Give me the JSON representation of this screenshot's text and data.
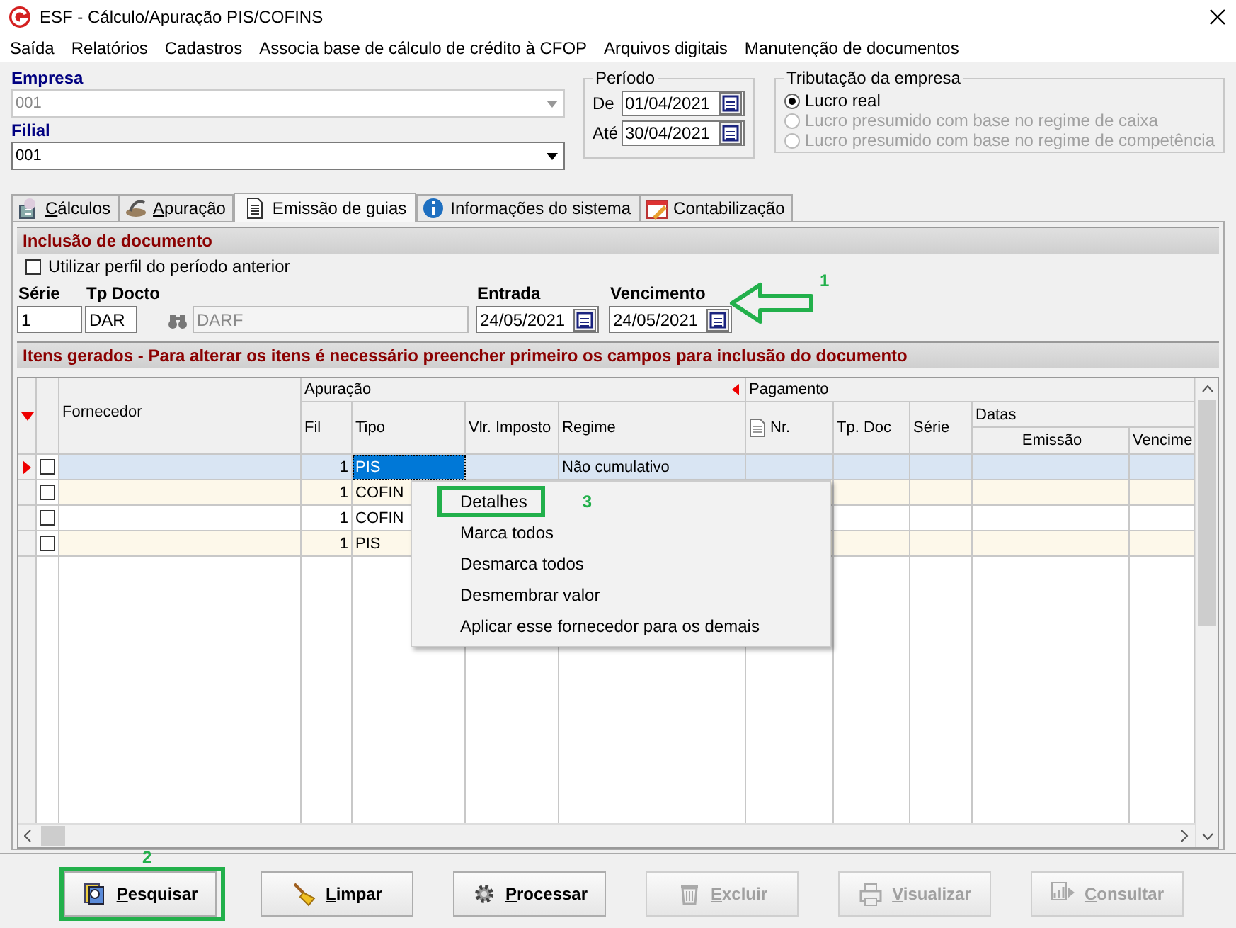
{
  "window": {
    "title": "ESF - Cálculo/Apuração PIS/COFINS"
  },
  "menu": [
    "Saída",
    "Relatórios",
    "Cadastros",
    "Associa base de cálculo de crédito à CFOP",
    "Arquivos digitais",
    "Manutenção de documentos"
  ],
  "empresa": {
    "label": "Empresa",
    "value": "001",
    "disabled": true
  },
  "filial": {
    "label": "Filial",
    "value": "001",
    "disabled": false
  },
  "periodo": {
    "title": "Período",
    "from_label": "De",
    "from": "01/04/2021",
    "to_label": "Até",
    "to": "30/04/2021"
  },
  "tributacao": {
    "title": "Tributação da empresa",
    "options": [
      {
        "label": "Lucro real",
        "selected": true,
        "disabled": false
      },
      {
        "label": "Lucro presumido com base no regime de caixa",
        "selected": false,
        "disabled": true
      },
      {
        "label": "Lucro presumido com base no regime de competência",
        "selected": false,
        "disabled": true
      }
    ]
  },
  "tabs": [
    {
      "label": "Cálculos",
      "selected": false
    },
    {
      "label": "Apuração",
      "selected": false
    },
    {
      "label": "Emissão de guias",
      "selected": true
    },
    {
      "label": "Informações do sistema",
      "selected": false
    },
    {
      "label": "Contabilização",
      "selected": false
    }
  ],
  "inclusao": {
    "title": "Inclusão de documento",
    "use_previous": {
      "label": "Utilizar perfil do período anterior",
      "checked": false
    },
    "serie": {
      "label": "Série",
      "value": "1"
    },
    "tp_docto": {
      "label": "Tp Docto",
      "value": "DAR",
      "description": "DARF"
    },
    "entrada": {
      "label": "Entrada",
      "value": "24/05/2021"
    },
    "vencimento": {
      "label": "Vencimento",
      "value": "24/05/2021"
    },
    "annotation": "1"
  },
  "itens": {
    "title": "Itens gerados - Para alterar os itens é necessário preencher primeiro os campos para inclusão do documento",
    "groups": [
      "Apuração",
      "Pagamento"
    ],
    "columns": {
      "fornecedor": "Fornecedor",
      "fil": "Fil",
      "tipo": "Tipo",
      "vlr": "Vlr. Imposto",
      "regime": "Regime",
      "nr": "Nr.",
      "tp_doc": "Tp. Doc",
      "serie": "Série",
      "datas": "Datas",
      "emissao": "Emissão",
      "vencimento": "Vencime"
    },
    "rows": [
      {
        "current": true,
        "checked": false,
        "selected": true,
        "fil": "1",
        "tipo": "PIS",
        "regime": "Não cumulativo"
      },
      {
        "current": false,
        "checked": false,
        "selected": false,
        "fil": "1",
        "tipo": "COFIN"
      },
      {
        "current": false,
        "checked": false,
        "selected": false,
        "fil": "1",
        "tipo": "COFIN"
      },
      {
        "current": false,
        "checked": false,
        "selected": false,
        "fil": "1",
        "tipo": "PIS"
      }
    ]
  },
  "context_menu": [
    {
      "label": "Detalhes",
      "annotation": "3"
    },
    {
      "label": "Marca todos"
    },
    {
      "label": "Desmarca todos"
    },
    {
      "label": "Desmembrar valor"
    },
    {
      "label": "Aplicar esse fornecedor para os demais"
    }
  ],
  "buttons": [
    {
      "label": "Pesquisar",
      "disabled": false,
      "annotation": "2"
    },
    {
      "label": "Limpar",
      "disabled": false
    },
    {
      "label": "Processar",
      "disabled": false
    },
    {
      "label": "Excluir",
      "disabled": true
    },
    {
      "label": "Visualizar",
      "disabled": true
    },
    {
      "label": "Consultar",
      "disabled": true
    }
  ]
}
